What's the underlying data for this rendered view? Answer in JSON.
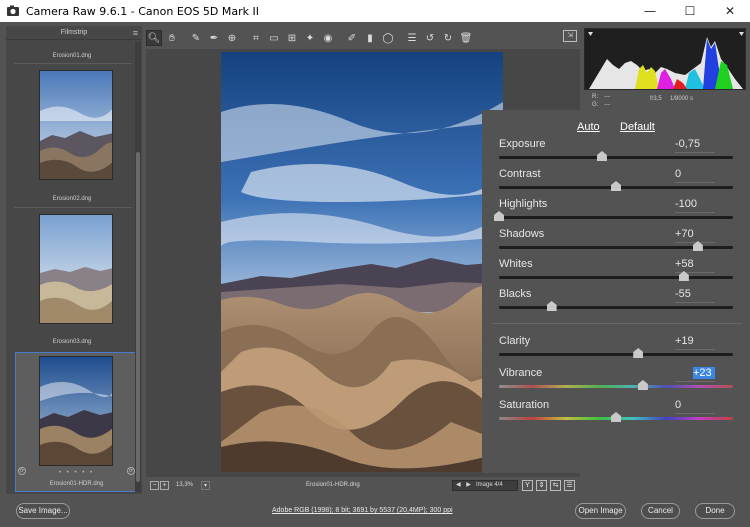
{
  "window": {
    "title": "Camera Raw 9.6.1  -  Canon EOS 5D Mark II",
    "minimize": "—",
    "maximize": "☐",
    "close": "✕"
  },
  "filmstrip": {
    "title": "Filmstrip",
    "items": [
      {
        "name": "Erosion01.dng"
      },
      {
        "name": "Erosion02.dng"
      },
      {
        "name": "Erosion03.dng"
      },
      {
        "name": "Erosion01-HDR.dng",
        "selected": true
      }
    ],
    "dots": "• • • • •"
  },
  "toolbar": {
    "tools": [
      "zoom-tool-icon",
      "hand-tool-icon",
      "white-balance-icon",
      "color-sampler-icon",
      "targeted-adjustment-icon",
      "crop-icon",
      "straighten-icon",
      "transform-icon",
      "spot-removal-icon",
      "red-eye-icon",
      "adjustment-brush-icon",
      "graduated-filter-icon",
      "radial-filter-icon",
      "preferences-icon",
      "rotate-left-icon",
      "rotate-right-icon",
      "trash-icon"
    ]
  },
  "histogram": {
    "r_label": "R:",
    "g_label": "G:",
    "r_val": "---",
    "g_val": "---",
    "aperture": "f/3,5",
    "shutter": "1/8000 s"
  },
  "adjustments": {
    "auto_label": "Auto",
    "default_label": "Default",
    "sliders": [
      {
        "label": "Exposure",
        "value": "-0,75",
        "pos": 0.44
      },
      {
        "label": "Contrast",
        "value": "0",
        "pos": 0.5
      },
      {
        "label": "Highlights",
        "value": "-100",
        "pos": 0.0
      },
      {
        "label": "Shadows",
        "value": "+70",
        "pos": 0.85
      },
      {
        "label": "Whites",
        "value": "+58",
        "pos": 0.79
      },
      {
        "label": "Blacks",
        "value": "-55",
        "pos": 0.225
      }
    ],
    "presence": [
      {
        "label": "Clarity",
        "value": "+19",
        "pos": 0.595
      },
      {
        "label": "Vibrance",
        "value": "+23",
        "pos": 0.615,
        "selected": true
      },
      {
        "label": "Saturation",
        "value": "0",
        "pos": 0.5
      }
    ]
  },
  "canvas": {
    "zoom_out": "−",
    "zoom_in": "+",
    "zoom": "13,3%",
    "filename": "Erosion01-HDR.dng",
    "nav_arrows": "◀ ▶",
    "image_count": "Image 4/4",
    "view_buttons": [
      "Y",
      "⇕",
      "⇆",
      "☰"
    ]
  },
  "bottom": {
    "save_label": "Save Image...",
    "workflow_link": "Adobe RGB (1998); 8 bit; 3691 by 5537 (20,4MP); 300 ppi",
    "open_label": "Open Image",
    "cancel_label": "Cancel",
    "done_label": "Done"
  },
  "colors": {
    "accent_select": "#4a7bd0",
    "value_highlight": "#3b86e0"
  }
}
